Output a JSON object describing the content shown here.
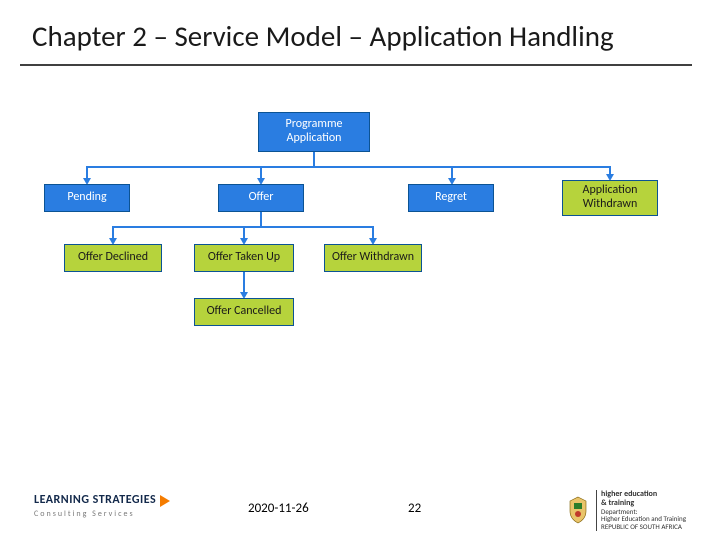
{
  "title": "Chapter 2 – Service Model – Application Handling",
  "nodes": {
    "root": "Programme Application",
    "pending": "Pending",
    "offer": "Offer",
    "regret": "Regret",
    "withdrawn": "Application Withdrawn",
    "declined": "Offer Declined",
    "takenup": "Offer Taken Up",
    "offerwithdrawn": "Offer Withdrawn",
    "cancelled": "Offer Cancelled"
  },
  "footer": {
    "date": "2020-11-26",
    "page": "22"
  },
  "logo_left": {
    "line1": "LEARNING STRATEGIES",
    "line2": "Consulting Services"
  },
  "logo_right": {
    "line1": "higher education",
    "line2": "& training",
    "line3": "Department:",
    "line4": "Higher Education and Training",
    "line5": "REPUBLIC OF SOUTH AFRICA"
  },
  "chart_data": {
    "type": "tree",
    "root": "Programme Application",
    "children": [
      {
        "label": "Pending",
        "style": "blue"
      },
      {
        "label": "Offer",
        "style": "blue",
        "children": [
          {
            "label": "Offer Declined",
            "style": "green"
          },
          {
            "label": "Offer Taken Up",
            "style": "green",
            "children": [
              {
                "label": "Offer Cancelled",
                "style": "green"
              }
            ]
          },
          {
            "label": "Offer Withdrawn",
            "style": "green"
          }
        ]
      },
      {
        "label": "Regret",
        "style": "blue"
      },
      {
        "label": "Application Withdrawn",
        "style": "green"
      }
    ]
  }
}
